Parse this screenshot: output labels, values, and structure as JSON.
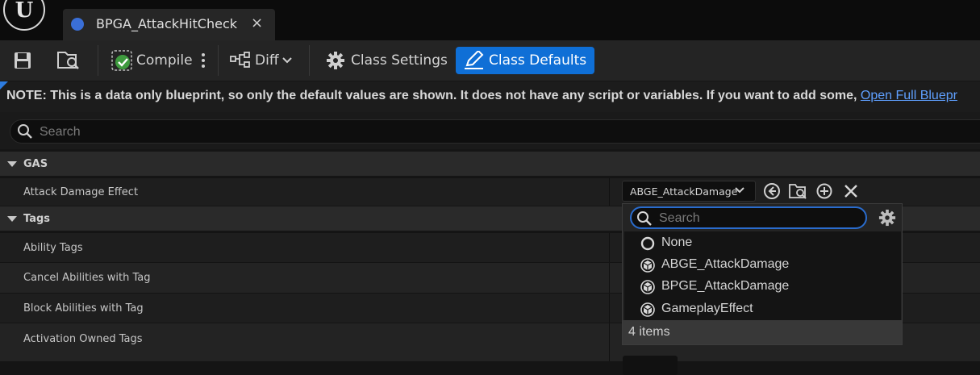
{
  "tabs": [
    {
      "label": "BPGA_AttackHitCheck",
      "close_glyph": "×"
    }
  ],
  "logo_glyph": "U",
  "toolbar": {
    "compile_label": "Compile",
    "diff_label": "Diff",
    "class_settings_label": "Class Settings",
    "class_defaults_label": "Class Defaults"
  },
  "notice": {
    "text": "NOTE: This is a data only blueprint, so only the default values are shown.  It does not have any script or variables.  If you want to add some,",
    "link": "Open Full Bluepr"
  },
  "search": {
    "placeholder": "Search"
  },
  "categories": [
    {
      "label": "GAS"
    },
    {
      "label": "Tags"
    }
  ],
  "properties": [
    {
      "label": "Attack Damage Effect"
    },
    {
      "label": "Ability Tags"
    },
    {
      "label": "Cancel Abilities with Tag"
    },
    {
      "label": "Block Abilities with Tag"
    },
    {
      "label": "Activation Owned Tags"
    }
  ],
  "asset_combo": {
    "value": "ABGE_AttackDamage"
  },
  "picker": {
    "search_placeholder": "Search",
    "items": [
      {
        "label": "None",
        "icon": "none-icon"
      },
      {
        "label": "ABGE_AttackDamage",
        "icon": "blueprint-class-icon"
      },
      {
        "label": "BPGE_AttackDamage",
        "icon": "blueprint-class-icon"
      },
      {
        "label": "GameplayEffect",
        "icon": "class-icon"
      }
    ],
    "footer": "4 items"
  },
  "colors": {
    "accent": "#0f6fd6",
    "link": "#5fa0ff",
    "focus": "#2a6ccd"
  }
}
